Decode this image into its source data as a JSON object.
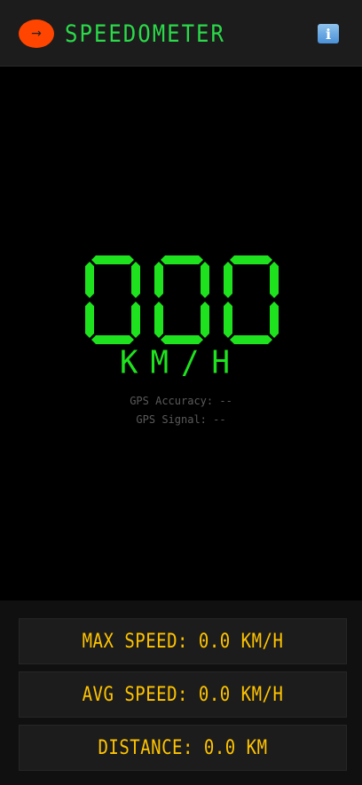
{
  "header": {
    "back_icon": "→",
    "title": "SPEEDOMETER",
    "info_icon": "i"
  },
  "speedometer": {
    "speed": "000",
    "unit": "KM/H",
    "gps_accuracy": "GPS Accuracy: --",
    "gps_signal": "GPS Signal: --",
    "digit_color": "#1fe21f"
  },
  "stats": {
    "max_speed": "MAX SPEED: 0.0 KM/H",
    "avg_speed": "AVG SPEED: 0.0 KM/H",
    "distance": "DISTANCE: 0.0 KM"
  },
  "colors": {
    "accent_orange": "#ff4500",
    "title_green": "#2bd94a",
    "stat_yellow": "#ffc400"
  }
}
